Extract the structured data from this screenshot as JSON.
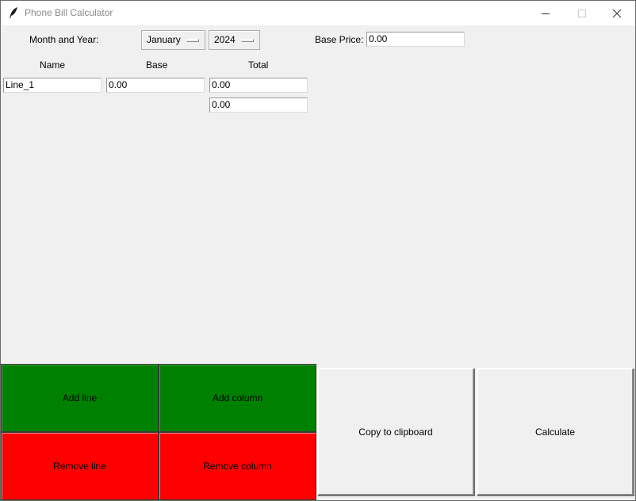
{
  "window": {
    "title": "Phone Bill Calculator",
    "controls": {
      "minimize": "minimize-icon",
      "maximize": "maximize-icon",
      "close": "close-icon"
    }
  },
  "header": {
    "month_year_label": "Month and Year:",
    "month_value": "January",
    "year_value": "2024",
    "base_price_label": "Base Price:",
    "base_price_value": "0.00"
  },
  "table": {
    "columns": [
      "Name",
      "Base",
      "Total"
    ],
    "rows": [
      {
        "name": "Line_1",
        "base": "0.00",
        "total": "0.00"
      }
    ],
    "column_totals": {
      "total": "0.00"
    }
  },
  "buttons": {
    "add_line": "Add line",
    "add_column": "Add column",
    "remove_line": "Remove line",
    "remove_column": "Remove column",
    "copy": "Copy to clipboard",
    "calculate": "Calculate"
  },
  "colors": {
    "add": "#008000",
    "remove": "#ff0000",
    "neutral": "#f0f0f0"
  }
}
